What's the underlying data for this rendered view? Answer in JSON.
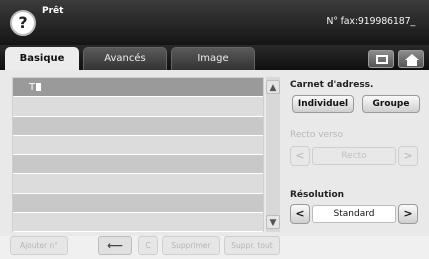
{
  "status": {
    "text": "Prêt",
    "fax_number": "N° fax:919986187_"
  },
  "tabs": [
    {
      "label": "Basique",
      "active": true
    },
    {
      "label": "Avancés",
      "active": false
    },
    {
      "label": "Image",
      "active": false
    }
  ],
  "header_icons": {
    "copy": "copy-screen-icon",
    "home": "home-icon",
    "help": "?"
  },
  "list": {
    "first_entry": "T",
    "row_count": 8
  },
  "scroll": {
    "up": "▲",
    "down": "▼"
  },
  "address_book": {
    "label": "Carnet d'adress.",
    "individual": "Individuel",
    "group": "Groupe"
  },
  "duplex": {
    "label": "Recto verso",
    "value": "Recto",
    "left": "<",
    "right": ">",
    "enabled": false
  },
  "resolution": {
    "label": "Résolution",
    "value": "Standard",
    "left": "<",
    "right": ">"
  },
  "bottom_buttons": {
    "add": "Ajouter n°",
    "back": "⟵",
    "clear": "C",
    "delete": "Supprimer",
    "delete_all": "Suppr. tout"
  }
}
